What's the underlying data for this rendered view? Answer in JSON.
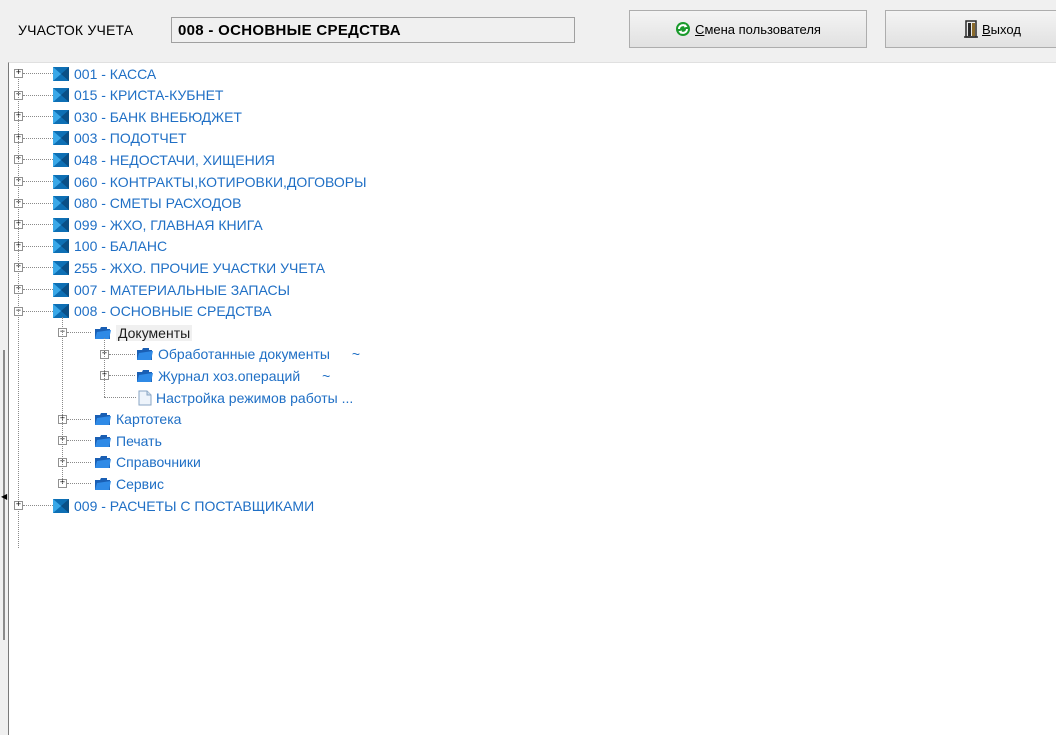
{
  "header": {
    "account_label": "УЧАСТОК УЧЕТА",
    "account_value": "008 - ОСНОВНЫЕ СРЕДСТВА",
    "change_user_button": {
      "underlined": "С",
      "rest": "мена пользователя",
      "icon": "refresh-icon"
    },
    "exit_button": {
      "underlined": "В",
      "rest": "ыход",
      "icon": "exit-door-icon"
    }
  },
  "tree": {
    "nodes": [
      {
        "label": "001 - КАССА",
        "expander": "+"
      },
      {
        "label": "015 - КРИСТА-КУБНЕТ",
        "expander": "+"
      },
      {
        "label": "030 - БАНК ВНЕБЮДЖЕТ",
        "expander": "+"
      },
      {
        "label": "003 - ПОДОТЧЕТ",
        "expander": "+"
      },
      {
        "label": "048 - НЕДОСТАЧИ, ХИЩЕНИЯ",
        "expander": "+"
      },
      {
        "label": "060 - КОНТРАКТЫ,КОТИРОВКИ,ДОГОВОРЫ",
        "expander": "+"
      },
      {
        "label": "080 - СМЕТЫ РАСХОДОВ",
        "expander": "+"
      },
      {
        "label": "099 - ЖХО, ГЛАВНАЯ КНИГА",
        "expander": "+"
      },
      {
        "label": "100 - БАЛАНС",
        "expander": "+"
      },
      {
        "label": "255 - ЖХО. ПРОЧИЕ УЧАСТКИ УЧЕТА",
        "expander": "+"
      },
      {
        "label": "007 - МАТЕРИАЛЬНЫЕ ЗАПАСЫ",
        "expander": "+"
      },
      {
        "label": "008 - ОСНОВНЫЕ СРЕДСТВА",
        "expander": "−"
      },
      {
        "label": "009 - РАСЧЕТЫ С ПОСТАВЩИКАМИ",
        "expander": "+"
      }
    ],
    "expanded_children": [
      {
        "label": "Документы",
        "expander": "−",
        "selected": true
      },
      {
        "label": "Картотека",
        "expander": "+"
      },
      {
        "label": "Печать",
        "expander": "+"
      },
      {
        "label": "Справочники",
        "expander": "+"
      },
      {
        "label": "Сервис",
        "expander": "+"
      }
    ],
    "document_children": [
      {
        "label": "Обработанные документы",
        "suffix": "~",
        "expander": "+"
      },
      {
        "label": "Журнал хоз.операций",
        "suffix": "~",
        "expander": "+"
      },
      {
        "label": "Настройка режимов работы ...",
        "suffix": "",
        "expander": ""
      }
    ],
    "colors": {
      "link": "#1f6fc5",
      "tree_lines": "#8a8a8a",
      "folder": "#1a73c9"
    }
  }
}
